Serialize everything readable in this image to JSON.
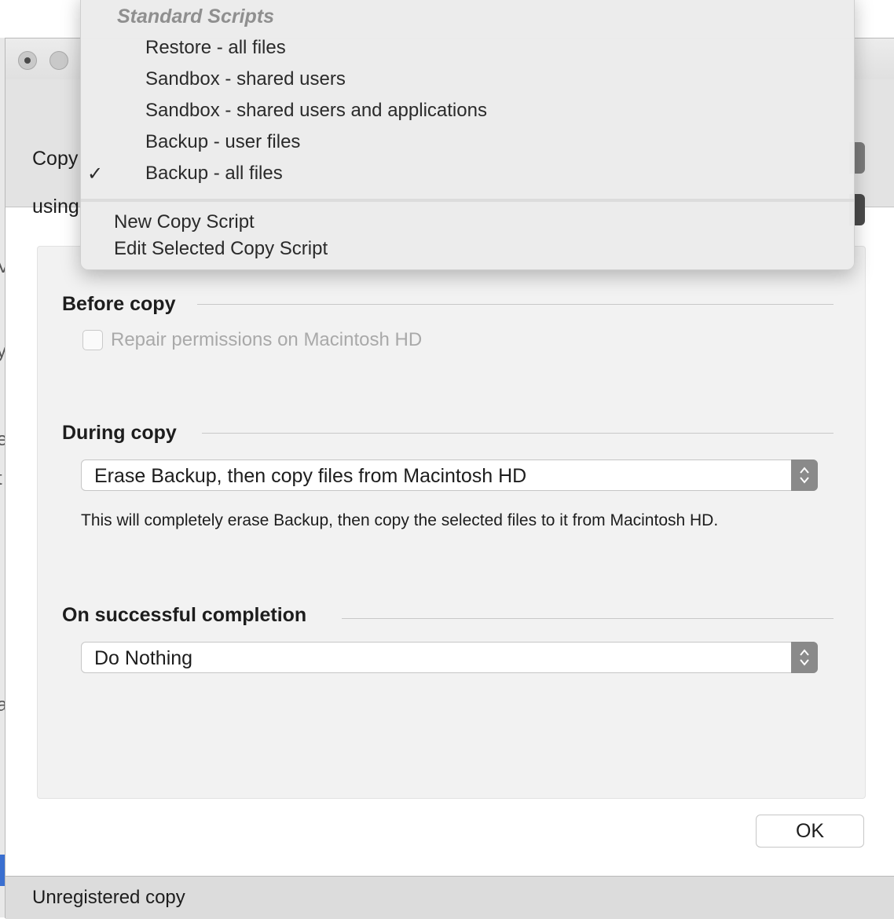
{
  "background": {
    "glyphs": [
      "V",
      "y",
      "e",
      "t",
      "a"
    ]
  },
  "toolbar": {
    "copy_label": "Copy",
    "using_label": "using"
  },
  "sections": {
    "before_copy": {
      "title": "Before copy",
      "checkbox_label": "Repair permissions on Macintosh HD",
      "checked": false
    },
    "during_copy": {
      "title": "During copy",
      "select_value": "Erase Backup, then copy files from Macintosh HD",
      "description": "This will completely erase Backup, then copy the selected files to it from Macintosh HD."
    },
    "on_completion": {
      "title": "On successful completion",
      "select_value": "Do Nothing"
    }
  },
  "ok_button": "OK",
  "status": "Unregistered copy",
  "menu": {
    "header": "Standard Scripts",
    "items": [
      {
        "label": "Restore - all files",
        "checked": false
      },
      {
        "label": "Sandbox - shared users",
        "checked": false
      },
      {
        "label": "Sandbox - shared users and applications",
        "checked": false
      },
      {
        "label": "Backup - user files",
        "checked": false
      },
      {
        "label": "Backup - all files",
        "checked": true
      }
    ],
    "check_mark": "✓",
    "actions": [
      "New Copy Script",
      "Edit Selected Copy Script"
    ]
  },
  "icons": {
    "window_close": "close-button-icon",
    "window_minimize": "minimize-button-icon",
    "stepper": "up-down-chevron-icon",
    "checkmark": "checkmark-icon"
  }
}
